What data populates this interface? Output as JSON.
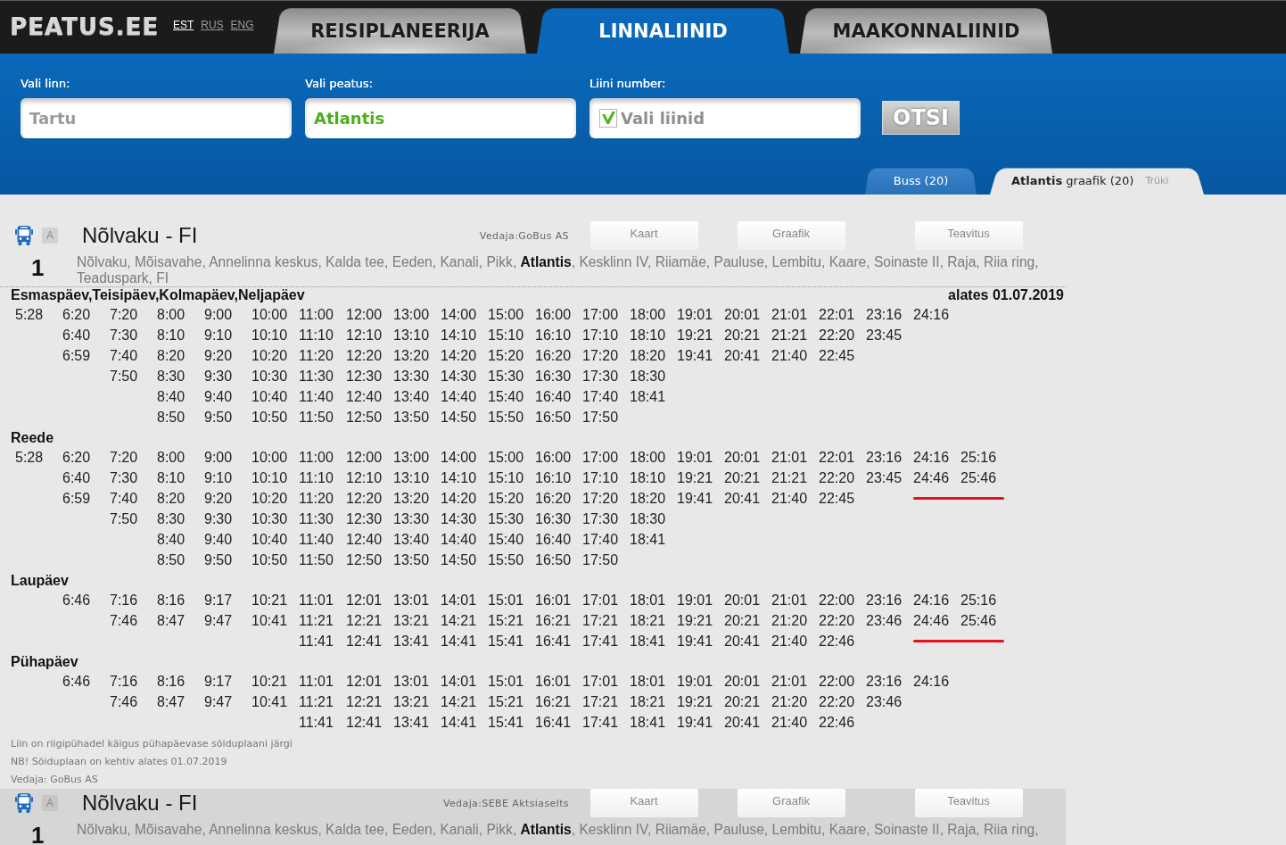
{
  "header": {
    "logo": "PEATUS.EE",
    "languages": [
      {
        "label": "EST",
        "selected": true
      },
      {
        "label": "RUS",
        "selected": false
      },
      {
        "label": "ENG",
        "selected": false
      }
    ],
    "tabs": [
      {
        "label": "REISIPLANEERIJA",
        "selected": false
      },
      {
        "label": "LINNALIINID",
        "selected": true
      },
      {
        "label": "MAAKONNALIINID",
        "selected": false
      }
    ]
  },
  "search": {
    "fields": [
      {
        "label": "Vali linn:",
        "kind": "plain",
        "value": "Tartu"
      },
      {
        "label": "Vali peatus:",
        "kind": "found",
        "value": "Atlantis"
      },
      {
        "label": "Liini number:",
        "kind": "checklist",
        "checkbox": {
          "checked": true
        },
        "placeholder": "Vali liinid"
      }
    ],
    "button": "OTSI"
  },
  "result_tabs": [
    {
      "label": "Buss (20)",
      "selected": false
    },
    {
      "label": "**Atlantis** graafik (20)",
      "selected": true,
      "link": "Trüki"
    }
  ],
  "routes": [
    {
      "highlighted": false,
      "badge": "A",
      "name": "Nõlvaku - FI",
      "operator": "Vedaja:GoBus AS",
      "buttons": [
        "Kaart",
        "Graafik",
        "Teavitus"
      ],
      "number": "1",
      "stops": "Nõlvaku, Mõisavahe, Annelinna keskus, Kalda tee, Eeden, Kanali, Pikk, **Atlantis**, Kesklinn IV, Riiamäe, Pauluse, Lembitu, Kaare, Soinaste II, Raja, Riia ring, Teaduspark, FI",
      "days": [
        {
          "title": "Esmaspäev,Teisipäev,Kolmapäev,Neljapäev",
          "valid_from": "alates 01.07.2019",
          "rows": [
            {
              "times": [
                "5:28",
                "6:20",
                "7:20",
                "8:00",
                "9:00",
                "10:00",
                "11:00",
                "12:00",
                "13:00",
                "14:00",
                "15:00",
                "16:00",
                "17:00",
                "18:00",
                "19:01",
                "20:01",
                "21:01",
                "22:01",
                "23:16",
                "24:16"
              ]
            },
            {
              "times": [
                "6:40",
                "7:30",
                "8:10",
                "9:10",
                "10:10",
                "11:10",
                "12:10",
                "13:10",
                "14:10",
                "15:10",
                "16:10",
                "17:10",
                "18:10",
                "19:21",
                "20:21",
                "21:21",
                "22:20",
                "23:45"
              ]
            },
            {
              "times": [
                "6:59",
                "7:40",
                "8:20",
                "9:20",
                "10:20",
                "11:20",
                "12:20",
                "13:20",
                "14:20",
                "15:20",
                "16:20",
                "17:20",
                "18:20",
                "19:41",
                "20:41",
                "21:40",
                "22:45"
              ]
            },
            {
              "times": [
                "7:50",
                "8:30",
                "9:30",
                "10:30",
                "11:30",
                "12:30",
                "13:30",
                "14:30",
                "15:30",
                "16:30",
                "17:30",
                "18:30"
              ]
            },
            {
              "times": [
                "8:40",
                "9:40",
                "10:40",
                "11:40",
                "12:40",
                "13:40",
                "14:40",
                "15:40",
                "16:40",
                "17:40",
                "18:41"
              ]
            },
            {
              "times": [
                "8:50",
                "9:50",
                "10:50",
                "11:50",
                "12:50",
                "13:50",
                "14:50",
                "15:50",
                "16:50",
                "17:50"
              ]
            }
          ]
        },
        {
          "title": "Reede",
          "rows": [
            {
              "times": [
                "5:28",
                "6:20",
                "7:20",
                "8:00",
                "9:00",
                "10:00",
                "11:00",
                "12:00",
                "13:00",
                "14:00",
                "15:00",
                "16:00",
                "17:00",
                "18:00",
                "19:01",
                "20:01",
                "21:01",
                "22:01",
                "23:16",
                "24:16",
                "25:16"
              ]
            },
            {
              "times": [
                "6:40",
                "7:30",
                "8:10",
                "9:10",
                "10:10",
                "11:10",
                "12:10",
                "13:10",
                "14:10",
                "15:10",
                "16:10",
                "17:10",
                "18:10",
                "19:21",
                "20:21",
                "21:21",
                "22:20",
                "23:45"
              ],
              "underlined_times": [
                "24:46",
                "25:46"
              ]
            },
            {
              "times": [
                "6:59",
                "7:40",
                "8:20",
                "9:20",
                "10:20",
                "11:20",
                "12:20",
                "13:20",
                "14:20",
                "15:20",
                "16:20",
                "17:20",
                "18:20",
                "19:41",
                "20:41",
                "21:40",
                "22:45"
              ]
            },
            {
              "times": [
                "7:50",
                "8:30",
                "9:30",
                "10:30",
                "11:30",
                "12:30",
                "13:30",
                "14:30",
                "15:30",
                "16:30",
                "17:30",
                "18:30"
              ]
            },
            {
              "times": [
                "8:40",
                "9:40",
                "10:40",
                "11:40",
                "12:40",
                "13:40",
                "14:40",
                "15:40",
                "16:40",
                "17:40",
                "18:41"
              ]
            },
            {
              "times": [
                "8:50",
                "9:50",
                "10:50",
                "11:50",
                "12:50",
                "13:50",
                "14:50",
                "15:50",
                "16:50",
                "17:50"
              ]
            }
          ]
        },
        {
          "title": "Laupäev",
          "rows": [
            {
              "times": [
                "6:46",
                "7:16",
                "8:16",
                "9:17",
                "10:21",
                "11:01",
                "12:01",
                "13:01",
                "14:01",
                "15:01",
                "16:01",
                "17:01",
                "18:01",
                "19:01",
                "20:01",
                "21:01",
                "22:00",
                "23:16",
                "24:16",
                "25:16"
              ]
            },
            {
              "times": [
                "7:46",
                "8:47",
                "9:47",
                "10:41",
                "11:21",
                "12:21",
                "13:21",
                "14:21",
                "15:21",
                "16:21",
                "17:21",
                "18:21",
                "19:21",
                "20:21",
                "21:20",
                "22:20",
                "23:46"
              ],
              "underlined_times": [
                "24:46",
                "25:46"
              ]
            },
            {
              "times": [
                "11:41",
                "12:41",
                "13:41",
                "14:41",
                "15:41",
                "16:41",
                "17:41",
                "18:41",
                "19:41",
                "20:41",
                "21:40",
                "22:46"
              ]
            }
          ]
        },
        {
          "title": "Pühapäev",
          "rows": [
            {
              "times": [
                "6:46",
                "7:16",
                "8:16",
                "9:17",
                "10:21",
                "11:01",
                "12:01",
                "13:01",
                "14:01",
                "15:01",
                "16:01",
                "17:01",
                "18:01",
                "19:01",
                "20:01",
                "21:01",
                "22:00",
                "23:16",
                "24:16"
              ]
            },
            {
              "times": [
                "7:46",
                "8:47",
                "9:47",
                "10:41",
                "11:21",
                "12:21",
                "13:21",
                "14:21",
                "15:21",
                "16:21",
                "17:21",
                "18:21",
                "19:21",
                "20:21",
                "21:20",
                "22:20",
                "23:46"
              ]
            },
            {
              "times": [
                "11:41",
                "12:41",
                "13:41",
                "14:41",
                "15:41",
                "16:41",
                "17:41",
                "18:41",
                "19:41",
                "20:41",
                "21:40",
                "22:46"
              ]
            }
          ]
        }
      ],
      "notes": [
        "Liin on riigipühadel käigus pühapäevase sõiduplaani järgi",
        "NB! Sõiduplaan on kehtiv alates 01.07.2019",
        "Vedaja: GoBus AS"
      ]
    },
    {
      "highlighted": true,
      "badge": "A",
      "name": "Nõlvaku - FI",
      "operator": "Vedaja:SEBE Aktsiaselts",
      "buttons": [
        "Kaart",
        "Graafik",
        "Teavitus"
      ],
      "number": "1",
      "stops": "Nõlvaku, Mõisavahe, Annelinna keskus, Kalda tee, Eeden, Kanali, Pikk, **Atlantis**, Kesklinn IV, Riiamäe, Pauluse, Lembitu, Kaare, Soinaste II, Raja, Riia ring,"
    }
  ]
}
